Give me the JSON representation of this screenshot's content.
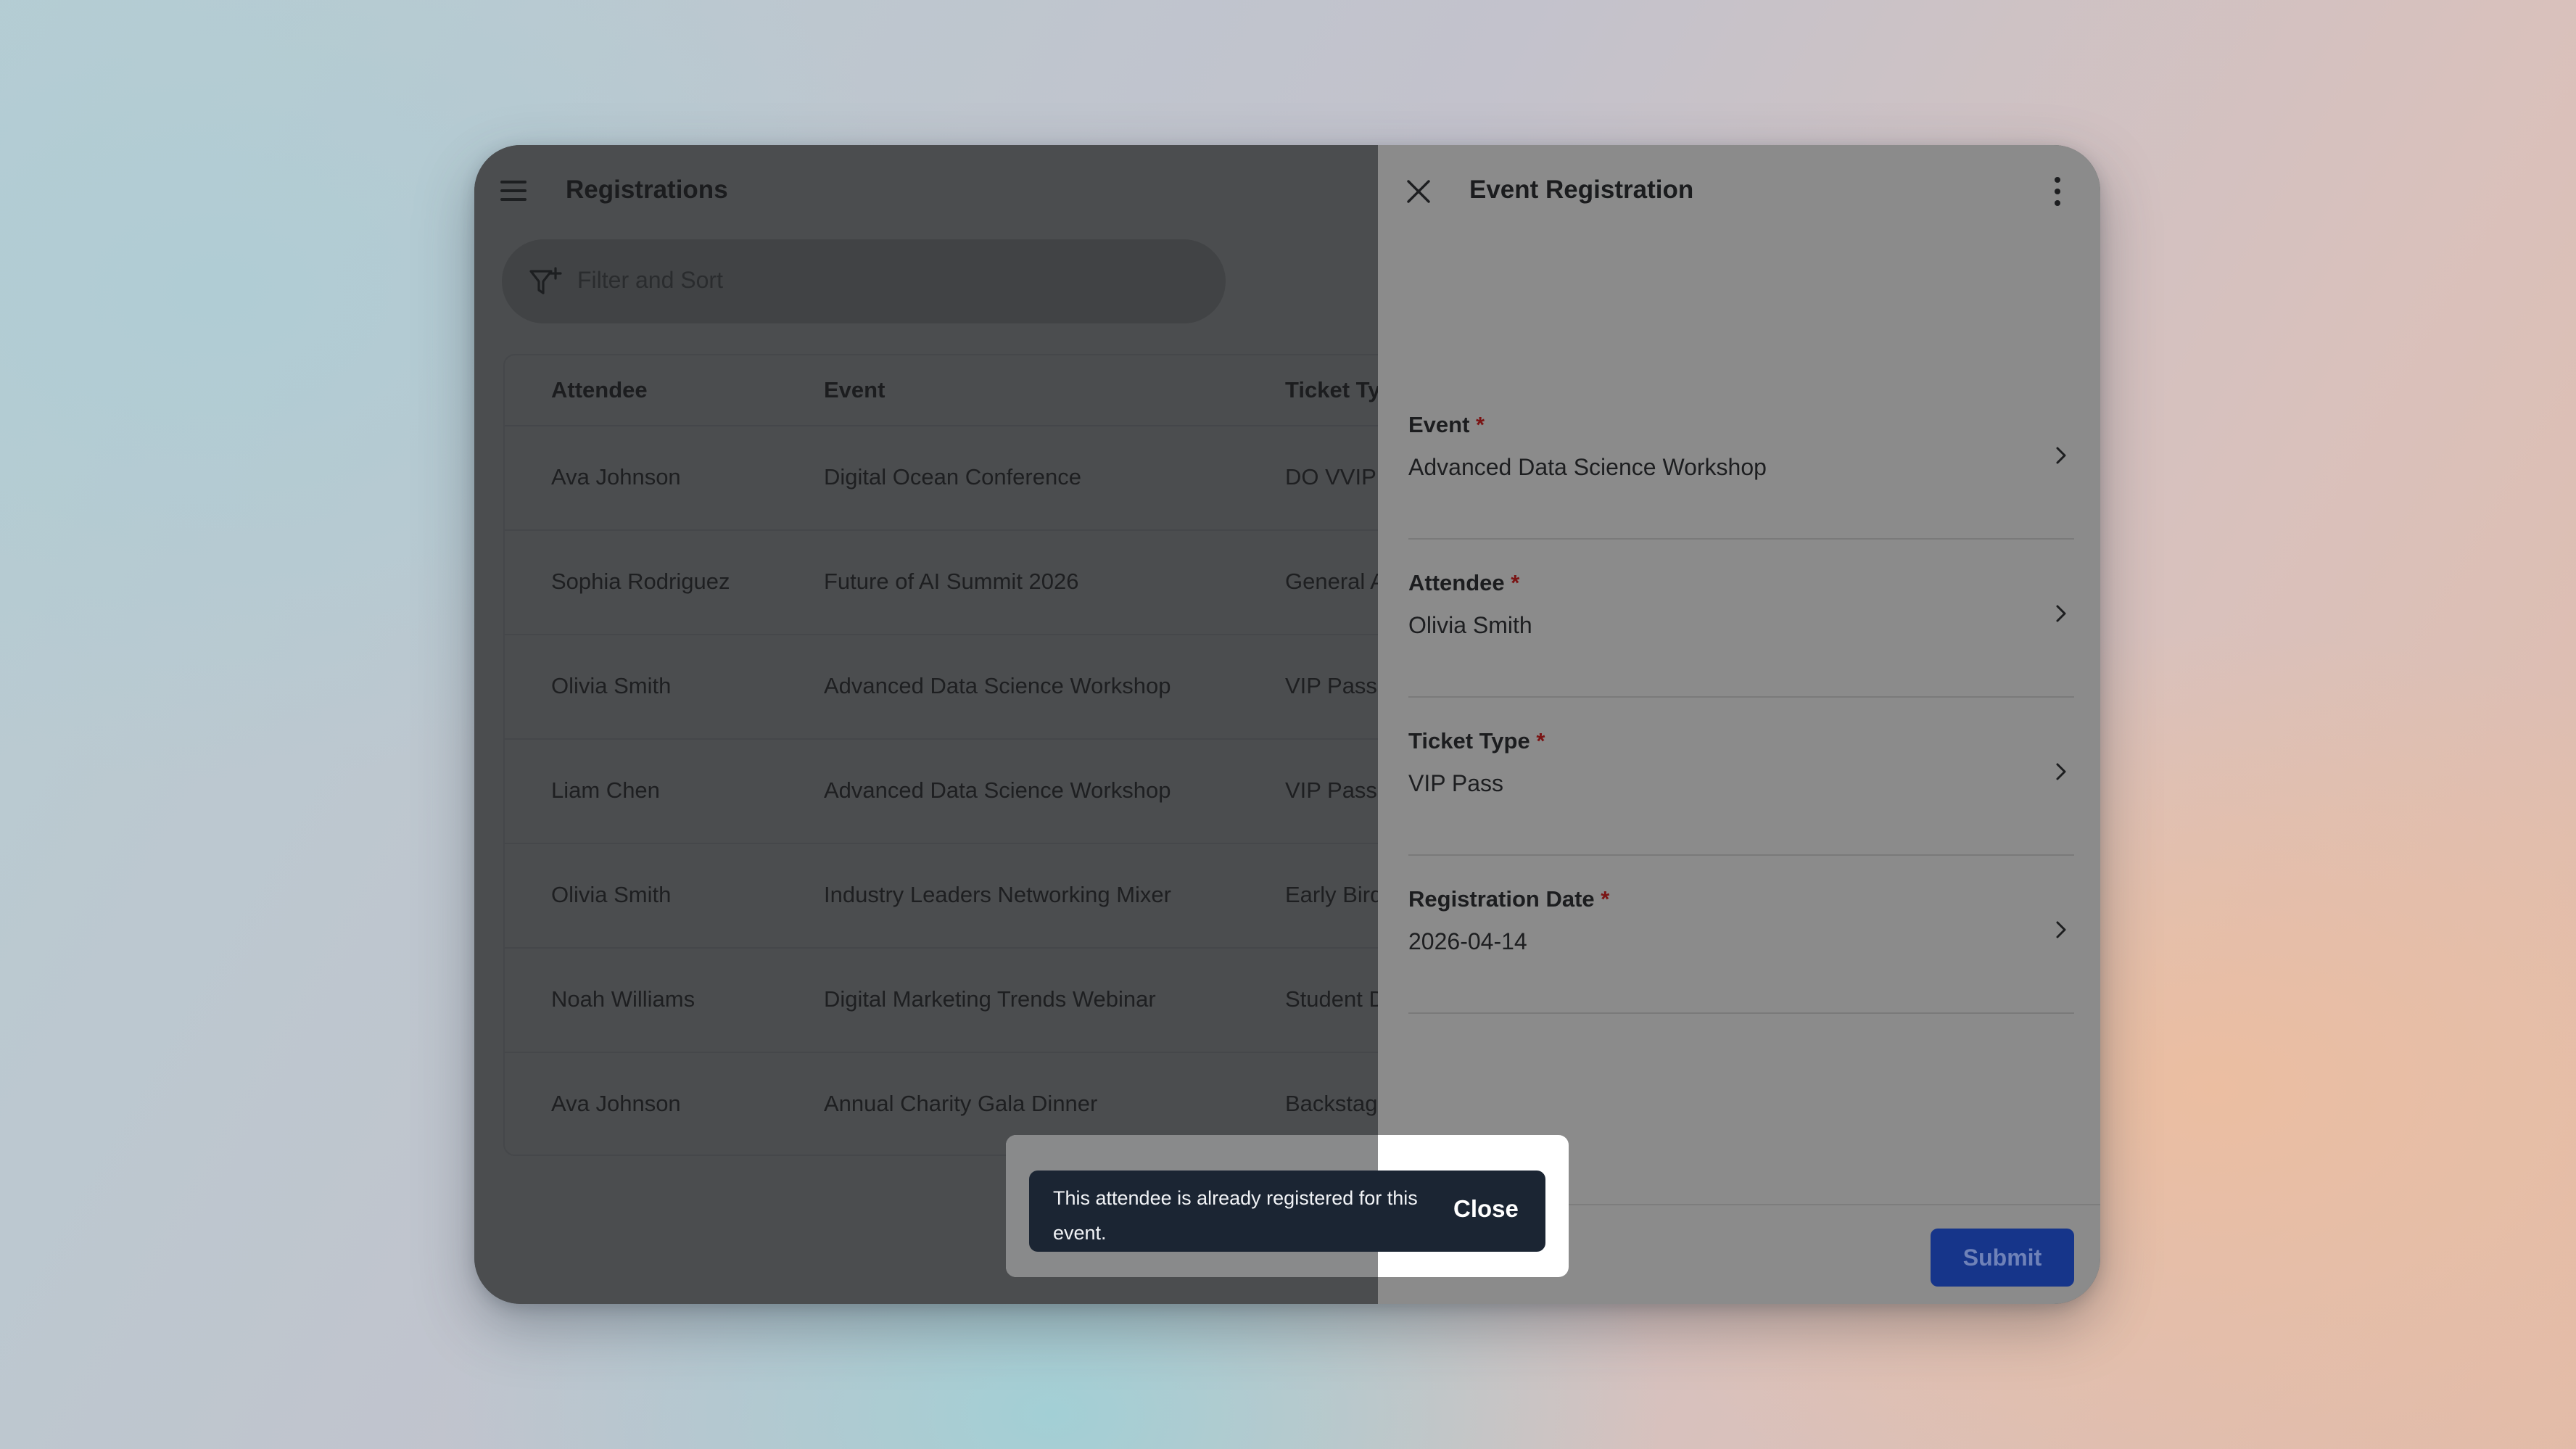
{
  "list": {
    "title": "Registrations",
    "filter_placeholder": "Filter and Sort",
    "columns": [
      "Attendee",
      "Event",
      "Ticket Ty"
    ],
    "rows": [
      {
        "attendee": "Ava Johnson",
        "event": "Digital Ocean Conference",
        "ticket": "DO VVIP"
      },
      {
        "attendee": "Sophia Rodriguez",
        "event": "Future of AI Summit 2026",
        "ticket": "General A"
      },
      {
        "attendee": "Olivia Smith",
        "event": "Advanced Data Science Workshop",
        "ticket": "VIP Pass"
      },
      {
        "attendee": "Liam Chen",
        "event": "Advanced Data Science Workshop",
        "ticket": "VIP Pass"
      },
      {
        "attendee": "Olivia Smith",
        "event": "Industry Leaders Networking Mixer",
        "ticket": "Early Bird"
      },
      {
        "attendee": "Noah Williams",
        "event": "Digital Marketing Trends Webinar",
        "ticket": "Student D"
      },
      {
        "attendee": "Ava Johnson",
        "event": "Annual Charity Gala Dinner",
        "ticket": "Backstag"
      }
    ]
  },
  "panel": {
    "title": "Event Registration",
    "required_marker": "*",
    "fields": [
      {
        "label": "Event",
        "value": "Advanced Data Science Workshop"
      },
      {
        "label": "Attendee",
        "value": "Olivia Smith"
      },
      {
        "label": "Ticket Type",
        "value": "VIP Pass"
      },
      {
        "label": "Registration Date",
        "value": "2026-04-14"
      }
    ],
    "submit_label": "Submit"
  },
  "toast": {
    "message": "This attendee is already registered for this event.",
    "close_label": "Close"
  },
  "icons": {
    "menu": "hamburger-menu-icon",
    "filter": "filter-add-icon",
    "close": "close-icon",
    "more": "more-vertical-icon",
    "chevron": "chevron-right-icon"
  }
}
